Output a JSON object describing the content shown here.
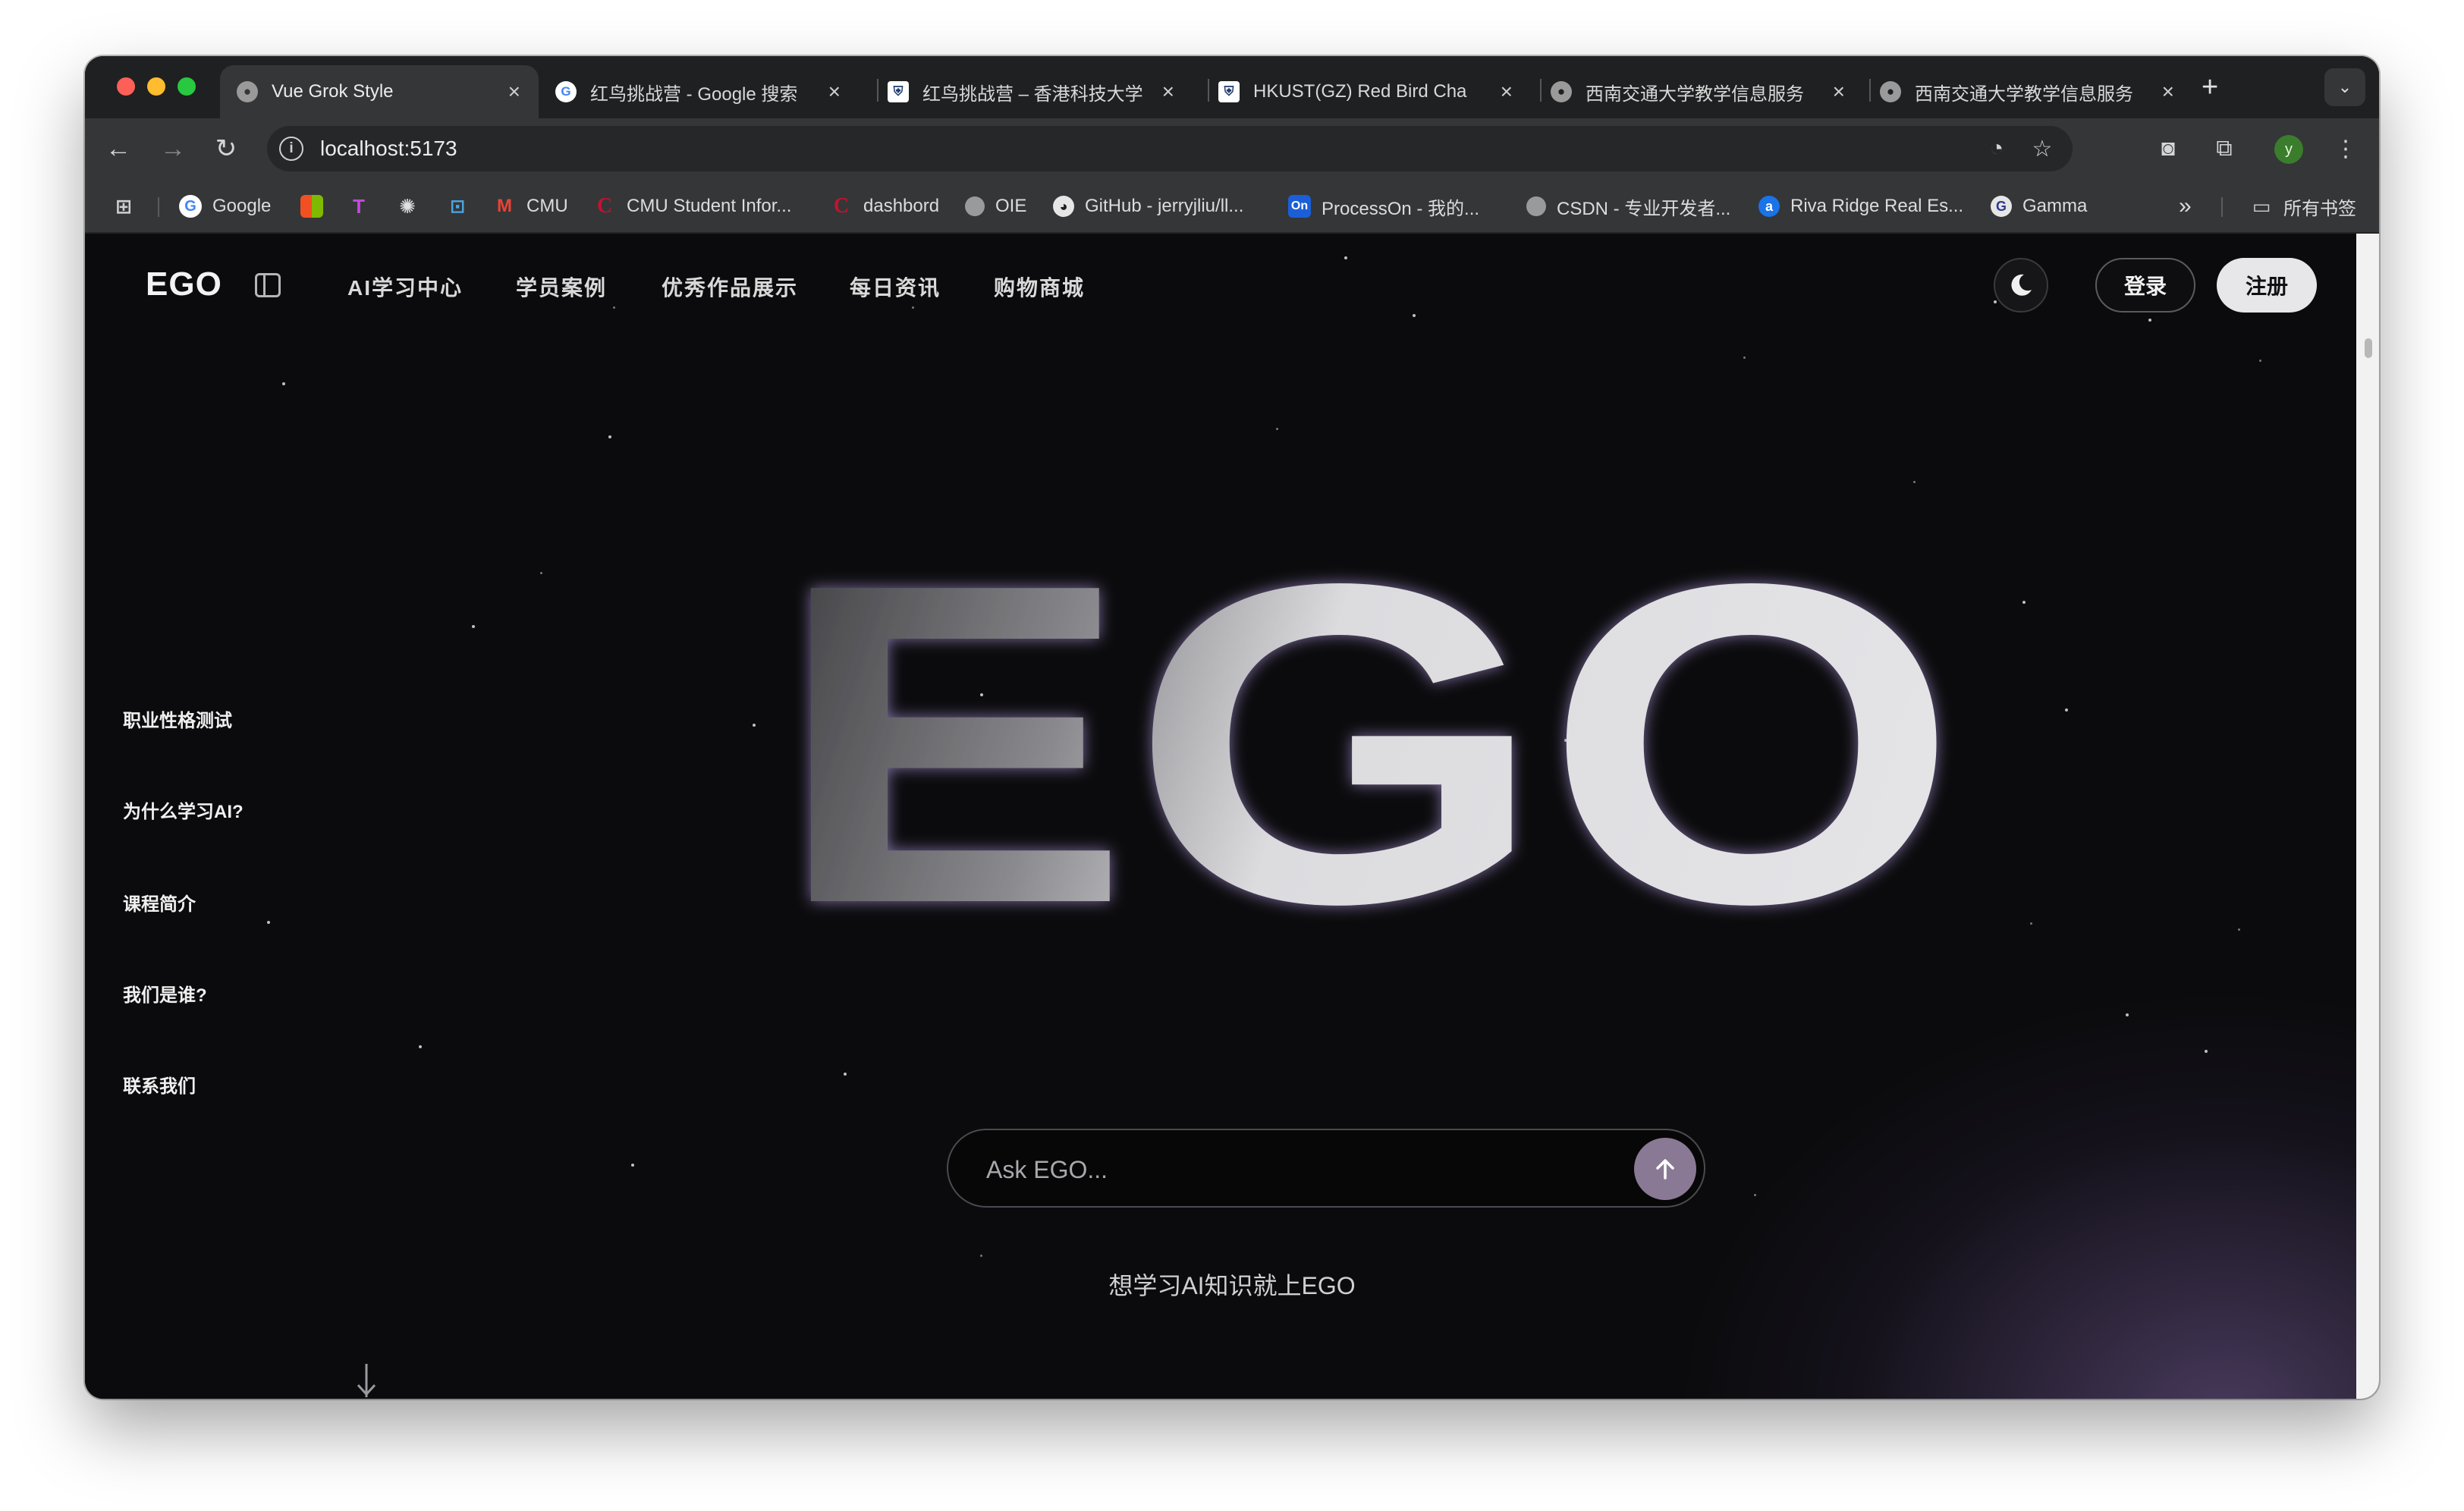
{
  "browser": {
    "tabs": [
      {
        "title": "Vue Grok Style",
        "icon": "globe-icon",
        "active": true
      },
      {
        "title": "红鸟挑战营 - Google 搜索",
        "icon": "google-icon",
        "active": false
      },
      {
        "title": "红鸟挑战营 – 香港科技大学",
        "icon": "university-shield-icon",
        "active": false
      },
      {
        "title": "HKUST(GZ) Red Bird Cha",
        "icon": "university-shield-icon",
        "active": false
      },
      {
        "title": "西南交通大学教学信息服务",
        "icon": "globe-icon",
        "active": false
      },
      {
        "title": "西南交通大学教学信息服务",
        "icon": "globe-icon",
        "active": false
      }
    ],
    "new_tab": "+",
    "url": "localhost:5173",
    "profile_initial": "y",
    "bookmarks": [
      {
        "label": "",
        "icon": "apps-grid-icon"
      },
      {
        "label": "Google",
        "icon": "google-icon"
      },
      {
        "label": "",
        "icon": "microsoft-icon"
      },
      {
        "label": "",
        "icon": "t-logo-icon"
      },
      {
        "label": "",
        "icon": "openai-icon"
      },
      {
        "label": "",
        "icon": "bilibili-icon"
      },
      {
        "label": "CMU",
        "icon": "gmail-icon"
      },
      {
        "label": "CMU Student Infor...",
        "icon": "canvas-c-icon"
      },
      {
        "label": "dashbord",
        "icon": "canvas-c-icon"
      },
      {
        "label": "OIE",
        "icon": "globe-icon"
      },
      {
        "label": "GitHub - jerryjliu/ll...",
        "icon": "github-icon"
      },
      {
        "label": "ProcessOn - 我的...",
        "icon": "processon-icon"
      },
      {
        "label": "CSDN - 专业开发者...",
        "icon": "globe-icon"
      },
      {
        "label": "Riva Ridge Real Es...",
        "icon": "riva-icon"
      },
      {
        "label": "Gamma",
        "icon": "gamma-icon"
      }
    ],
    "bookmarks_overflow": "»",
    "all_bookmarks": "所有书签"
  },
  "site": {
    "logo": "EGO",
    "nav": [
      "AI学习中心",
      "学员案例",
      "优秀作品展示",
      "每日资讯",
      "购物商城"
    ],
    "login": "登录",
    "register": "注册",
    "side_links": [
      "职业性格测试",
      "为什么学习AI?",
      "课程简介",
      "我们是谁?",
      "联系我们"
    ],
    "hero_text": "EGO",
    "ask_placeholder": "Ask EGO...",
    "tagline": "想学习AI知识就上EGO"
  },
  "colors": {
    "accent_purple": "#8a7994",
    "page_bg": "#0b0b0d",
    "register_bg": "#e7e7e9"
  }
}
